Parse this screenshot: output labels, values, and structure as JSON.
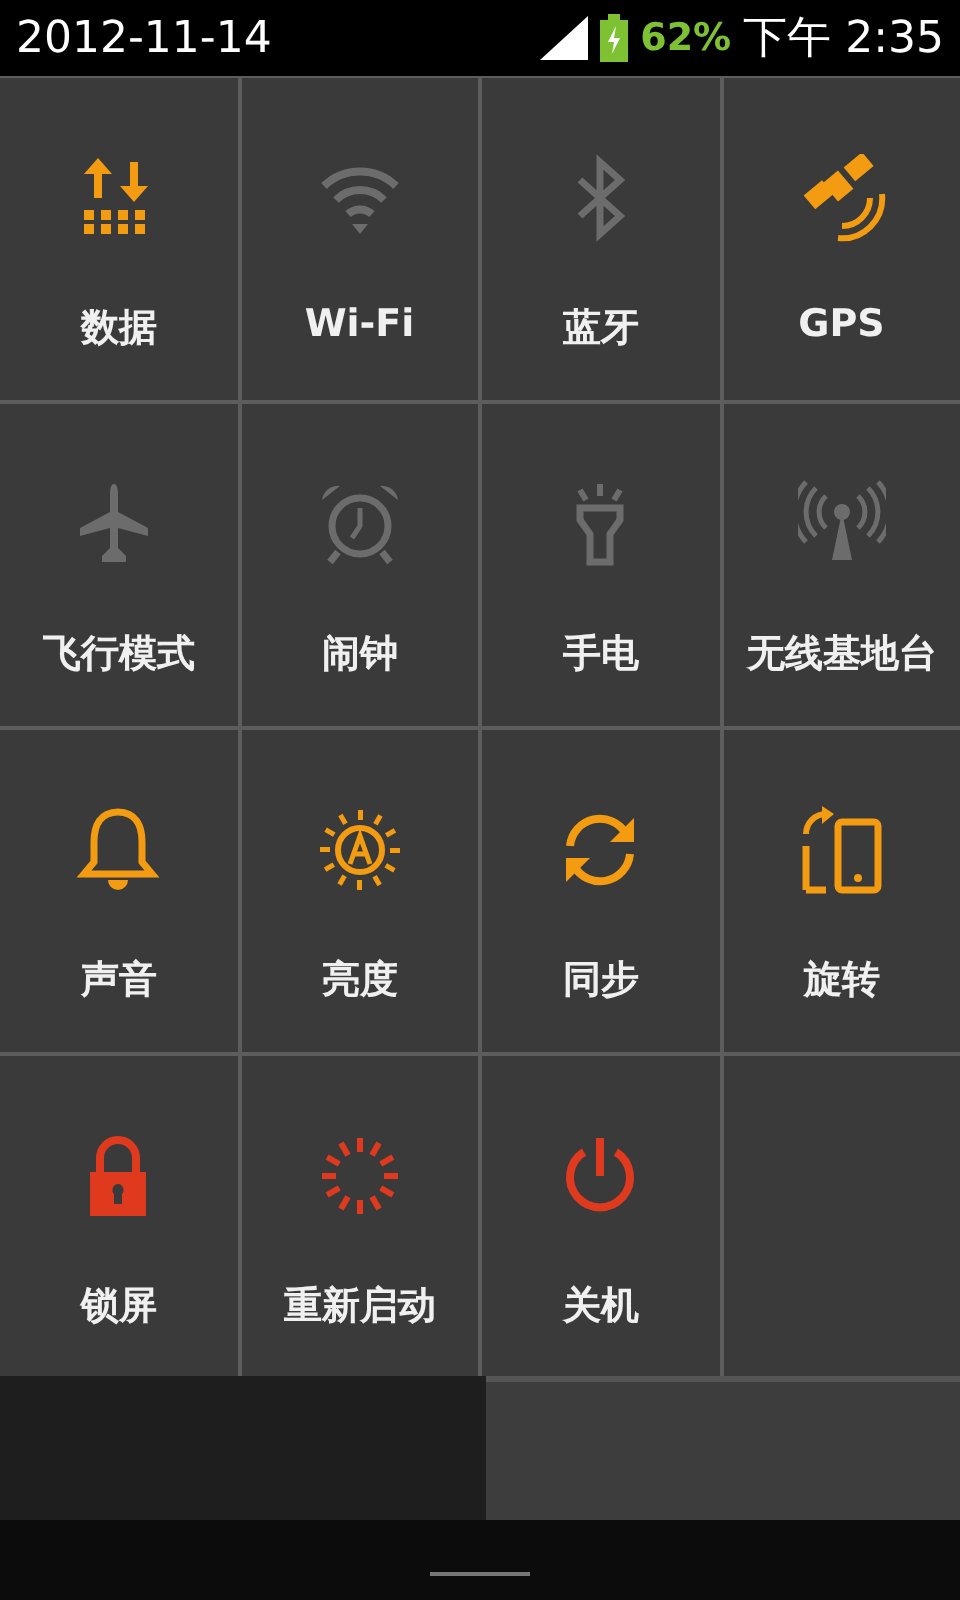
{
  "status_bar": {
    "date": "2012-11-14",
    "battery_percent": "62%",
    "time": "下午 2:35"
  },
  "tiles": [
    {
      "label": "数据",
      "kind": "toggle",
      "on": true
    },
    {
      "label": "Wi-Fi",
      "kind": "toggle",
      "on": false
    },
    {
      "label": "蓝牙",
      "kind": "toggle",
      "on": false
    },
    {
      "label": "GPS",
      "kind": "toggle",
      "on": true
    },
    {
      "label": "飞行模式",
      "kind": "toggle",
      "on": false
    },
    {
      "label": "闹钟",
      "kind": "toggle",
      "on": false
    },
    {
      "label": "手电",
      "kind": "toggle",
      "on": false
    },
    {
      "label": "无线基地台",
      "kind": "toggle",
      "on": false
    },
    {
      "label": "声音",
      "kind": "toggle",
      "on": true
    },
    {
      "label": "亮度",
      "kind": "toggle",
      "on": true
    },
    {
      "label": "同步",
      "kind": "toggle",
      "on": true
    },
    {
      "label": "旋转",
      "kind": "toggle",
      "on": true
    },
    {
      "label": "锁屏",
      "kind": "action"
    },
    {
      "label": "重新启动",
      "kind": "action"
    },
    {
      "label": "关机",
      "kind": "action"
    }
  ]
}
